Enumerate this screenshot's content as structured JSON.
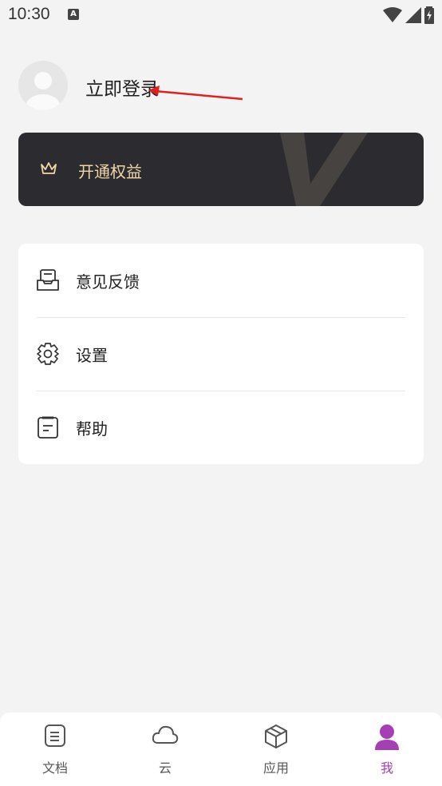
{
  "status_bar": {
    "time": "10:30",
    "notification_icon": "a-icon",
    "icons": [
      "wifi-icon",
      "cellular-signal-icon",
      "battery-charging-icon"
    ]
  },
  "profile": {
    "login_label": "立即登录",
    "avatar_icon": "default-user-avatar-icon"
  },
  "vip": {
    "label": "开通权益",
    "icon": "crown-icon",
    "accent_color": "#f1d6a6"
  },
  "menu": {
    "items": [
      {
        "label": "意见反馈",
        "icon": "feedback-inbox-icon"
      },
      {
        "label": "设置",
        "icon": "gear-icon"
      },
      {
        "label": "帮助",
        "icon": "help-document-icon"
      }
    ]
  },
  "tabbar": {
    "active_color": "#a43fb4",
    "tabs": [
      {
        "label": "文档",
        "icon": "document-icon"
      },
      {
        "label": "云",
        "icon": "cloud-icon"
      },
      {
        "label": "应用",
        "icon": "cube-box-icon"
      },
      {
        "label": "我",
        "icon": "person-icon"
      }
    ]
  }
}
